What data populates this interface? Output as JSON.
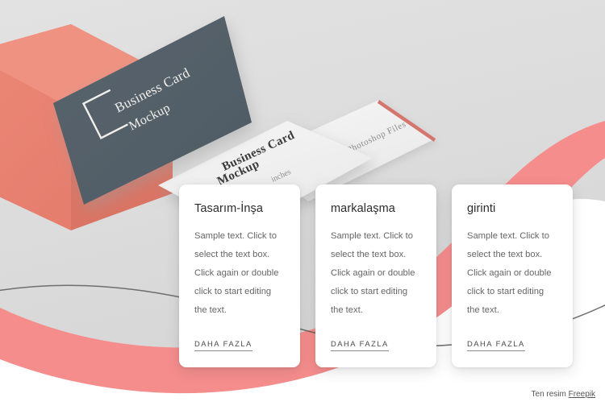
{
  "palette": {
    "background_gray": "#dedede",
    "background_white": "#ffffff",
    "wave_pink": "#f68d8d",
    "box_coral": "#e8806f",
    "box_coral_dark": "#d4705f",
    "card_dark": "#56626b",
    "card_dark_edge": "#4a555d",
    "mockup_white": "#f2f2f2",
    "mockup_edge_red": "#d4756e",
    "line_dark": "#5a5a5a",
    "text_title": "#2b2b2b",
    "text_body": "#666666",
    "link": "#4a4a4a"
  },
  "hero": {
    "dark_card": {
      "logo": "bracket-logo",
      "line1": "Business Card",
      "line2": "Mockup"
    },
    "mockup_card_front": {
      "line1": "Business Card",
      "line2": "Mockup",
      "line3": "inches"
    },
    "mockup_card_back": {
      "label": "Photoshop Files"
    }
  },
  "cards": [
    {
      "title": "Tasarım-İnşa",
      "body": "Sample text. Click to select the text box. Click again or double click to start editing the text.",
      "link_label": "DAHA FAZLA"
    },
    {
      "title": "markalaşma",
      "body": "Sample text. Click to select the text box. Click again or double click to start editing the text.",
      "link_label": "DAHA FAZLA"
    },
    {
      "title": "girinti",
      "body": "Sample text. Click to select the text box. Click again or double click to start editing the text.",
      "link_label": "DAHA FAZLA"
    }
  ],
  "attribution": {
    "prefix": "Ten resim ",
    "link_label": "Freepik"
  }
}
